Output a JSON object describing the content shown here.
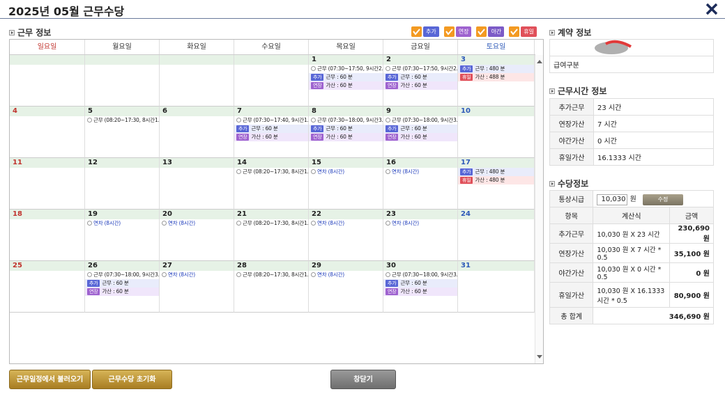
{
  "title": "2025년 05월 근무수당",
  "work_section": "근무 정보",
  "legend": [
    {
      "label": "추가",
      "color": "#5866d6"
    },
    {
      "label": "연장",
      "color": "#9e62cf"
    },
    {
      "label": "야간",
      "color": "#7c5bc7"
    },
    {
      "label": "휴일",
      "color": "#e0505a"
    }
  ],
  "weekdays": [
    "일요일",
    "월요일",
    "화요일",
    "수요일",
    "목요일",
    "금요일",
    "토요일"
  ],
  "weeks": [
    [
      {
        "d": ""
      },
      {
        "d": ""
      },
      {
        "d": ""
      },
      {
        "d": ""
      },
      {
        "d": "1",
        "ev": [
          {
            "t": "work",
            "x": "근무 (07:30~17:50, 9시간2…"
          },
          {
            "t": "add",
            "x": "근무 : 60 분"
          },
          {
            "t": "ext",
            "x": "가산 : 60 분"
          }
        ]
      },
      {
        "d": "2",
        "ev": [
          {
            "t": "work",
            "x": "근무 (07:30~17:50, 9시간2…"
          },
          {
            "t": "add",
            "x": "근무 : 60 분"
          },
          {
            "t": "ext",
            "x": "가산 : 60 분"
          }
        ]
      },
      {
        "d": "3",
        "ev": [
          {
            "t": "add",
            "x": "근무 : 480 분"
          },
          {
            "t": "hol",
            "x": "가산 : 488 분"
          }
        ]
      }
    ],
    [
      {
        "d": "4"
      },
      {
        "d": "5",
        "ev": [
          {
            "t": "work",
            "x": "근무 (08:20~17:30, 8시간1…"
          }
        ]
      },
      {
        "d": "6"
      },
      {
        "d": "7",
        "ev": [
          {
            "t": "work",
            "x": "근무 (07:30~17:40, 9시간1…"
          },
          {
            "t": "add",
            "x": "근무 : 60 분"
          },
          {
            "t": "ext",
            "x": "가산 : 60 분"
          }
        ]
      },
      {
        "d": "8",
        "ev": [
          {
            "t": "work",
            "x": "근무 (07:30~18:00, 9시간3…"
          },
          {
            "t": "add",
            "x": "근무 : 60 분"
          },
          {
            "t": "ext",
            "x": "가산 : 60 분"
          }
        ]
      },
      {
        "d": "9",
        "ev": [
          {
            "t": "work",
            "x": "근무 (07:30~18:00, 9시간3…"
          },
          {
            "t": "add",
            "x": "근무 : 60 분"
          },
          {
            "t": "ext",
            "x": "가산 : 60 분"
          }
        ]
      },
      {
        "d": "10"
      }
    ],
    [
      {
        "d": "11"
      },
      {
        "d": "12"
      },
      {
        "d": "13"
      },
      {
        "d": "14",
        "ev": [
          {
            "t": "work",
            "x": "근무 (08:20~17:30, 8시간1…"
          }
        ]
      },
      {
        "d": "15",
        "ev": [
          {
            "t": "leave",
            "x": "연차 (8시간)"
          }
        ]
      },
      {
        "d": "16",
        "ev": [
          {
            "t": "leave",
            "x": "연차 (8시간)"
          }
        ]
      },
      {
        "d": "17",
        "ev": [
          {
            "t": "add",
            "x": "근무 : 480 분"
          },
          {
            "t": "hol",
            "x": "가산 : 480 분"
          }
        ]
      }
    ],
    [
      {
        "d": "18"
      },
      {
        "d": "19",
        "ev": [
          {
            "t": "leave",
            "x": "연차 (8시간)"
          }
        ]
      },
      {
        "d": "20",
        "ev": [
          {
            "t": "leave",
            "x": "연차 (8시간)"
          }
        ]
      },
      {
        "d": "21",
        "ev": [
          {
            "t": "work",
            "x": "근무 (08:20~17:30, 8시간1…"
          }
        ]
      },
      {
        "d": "22",
        "ev": [
          {
            "t": "leave",
            "x": "연차 (8시간)"
          }
        ]
      },
      {
        "d": "23",
        "ev": [
          {
            "t": "leave",
            "x": "연차 (8시간)"
          }
        ]
      },
      {
        "d": "24"
      }
    ],
    [
      {
        "d": "25"
      },
      {
        "d": "26",
        "ev": [
          {
            "t": "work",
            "x": "근무 (07:30~18:00, 9시간3…"
          },
          {
            "t": "add",
            "x": "근무 : 60 분"
          },
          {
            "t": "ext",
            "x": "가산 : 60 분"
          }
        ]
      },
      {
        "d": "27",
        "ev": [
          {
            "t": "leave",
            "x": "연차 (8시간)"
          }
        ]
      },
      {
        "d": "28",
        "ev": [
          {
            "t": "work",
            "x": "근무 (08:20~17:30, 8시간1…"
          }
        ]
      },
      {
        "d": "29",
        "ev": [
          {
            "t": "leave",
            "x": "연차 (8시간)"
          }
        ]
      },
      {
        "d": "30",
        "ev": [
          {
            "t": "work",
            "x": "근무 (07:30~18:00, 9시간3…"
          },
          {
            "t": "add",
            "x": "근무 : 60 분"
          },
          {
            "t": "ext",
            "x": "가산 : 60 분"
          }
        ]
      },
      {
        "d": "31"
      }
    ]
  ],
  "contract": {
    "title": "계약 정보",
    "row2_label": "급여구분"
  },
  "hours": {
    "title": "근무시간 정보",
    "rows": [
      [
        "추가근무",
        "23 시간"
      ],
      [
        "연장가산",
        "7 시간"
      ],
      [
        "야간가산",
        "0 시간"
      ],
      [
        "휴일가산",
        "16.1333 시간"
      ]
    ]
  },
  "allow": {
    "title": "수당정보",
    "wage_label": "통상시급",
    "wage_value": "10,030",
    "wage_unit": "원",
    "edit_btn": "수정",
    "head": [
      "항목",
      "계산식",
      "금액"
    ],
    "rows": [
      [
        "추가근무",
        "10,030 원 X 23 시간",
        "230,690 원"
      ],
      [
        "연장가산",
        "10,030 원 X 7 시간 * 0.5",
        "35,100 원"
      ],
      [
        "야간가산",
        "10,030 원 X 0 시간 * 0.5",
        "0 원"
      ],
      [
        "휴일가산",
        "10,030 원 X 16.1333 시간 * 0.5",
        "80,900 원"
      ]
    ],
    "total_label": "총 합계",
    "total_value": "346,690 원"
  },
  "buttons": {
    "load": "근무일정에서 불러오기",
    "reset": "근무수당 초기화",
    "close": "창닫기"
  }
}
